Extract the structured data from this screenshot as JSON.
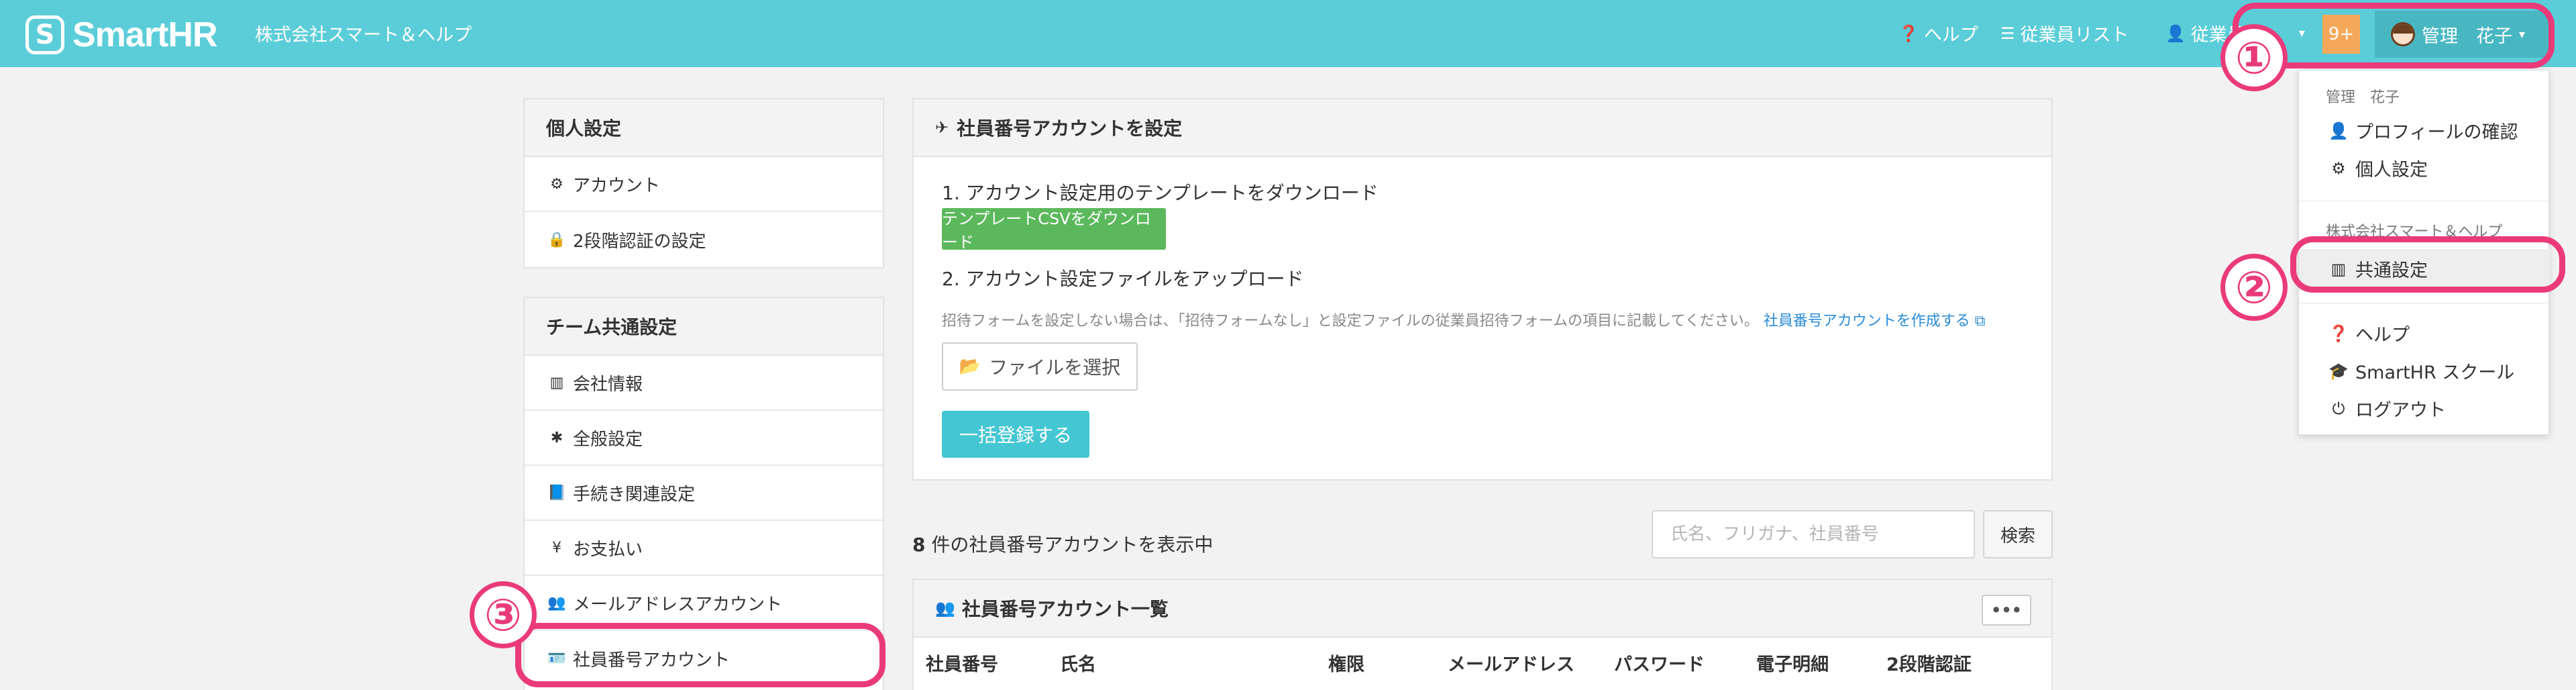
{
  "header": {
    "logo_mark": "S",
    "logo_text": "SmartHR",
    "company": "株式会社スマート＆ヘルプ",
    "nav": {
      "help": "ヘルプ",
      "employee_list": "従業員リスト",
      "employee_menu": "従業員"
    },
    "badge": "9+",
    "user_name": "管理　花子",
    "icons": {
      "help": "question-circle-icon",
      "employee_list": "list-icon",
      "employee_menu": "user-icon",
      "caret": "caret-down-icon"
    }
  },
  "dropdown": {
    "user_header": "管理　花子",
    "company_header": "株式会社スマート＆ヘルプ",
    "items": {
      "profile": "プロフィールの確認",
      "personal": "個人設定",
      "common": "共通設定",
      "help": "ヘルプ",
      "school": "SmartHR スクール",
      "logout": "ログアウト"
    }
  },
  "personal_settings": {
    "title": "個人設定",
    "items": [
      "アカウント",
      "2段階認証の設定"
    ]
  },
  "team_settings": {
    "title": "チーム共通設定",
    "items": [
      "会社情報",
      "全般設定",
      "手続き関連設定",
      "お支払い",
      "メールアドレスアカウント",
      "社員番号アカウント"
    ]
  },
  "main": {
    "title": "社員番号アカウントを設定",
    "step1": "1. アカウント設定用のテンプレートをダウンロード",
    "download_button": "テンプレートCSVをダウンロード",
    "step2": "2. アカウント設定ファイルをアップロード",
    "note": "招待フォームを設定しない場合は、「招待フォームなし」と設定ファイルの従業員招待フォームの項目に記載してください。",
    "note_link": "社員番号アカウントを作成する",
    "file_button": "ファイルを選択",
    "register_button": "一括登録する"
  },
  "list": {
    "count_number": "8",
    "count_text": " 件の社員番号アカウントを表示中",
    "search_placeholder": "氏名、フリガナ、社員番号",
    "search_button": "検索",
    "title": "社員番号アカウント一覧",
    "more_button": "•••",
    "columns": [
      "社員番号",
      "氏名",
      "権限",
      "メールアドレス",
      "パスワード",
      "電子明細",
      "2段階認証"
    ]
  },
  "annotations": [
    "①",
    "②",
    "③"
  ],
  "colors": {
    "header": "#5bcdd8",
    "accent": "#ea3a7a",
    "green": "#5cb85c",
    "cyan": "#45c6d3",
    "badge": "#f6a85a"
  }
}
